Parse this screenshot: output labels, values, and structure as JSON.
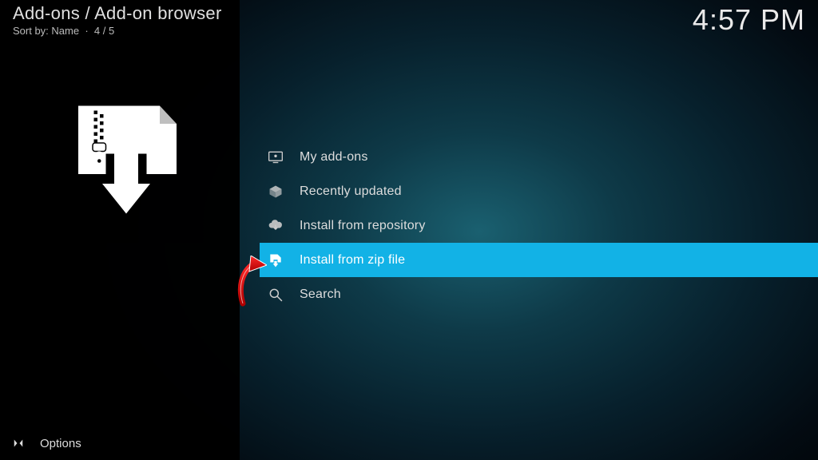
{
  "header": {
    "breadcrumb": "Add-ons / Add-on browser",
    "sort_label": "Sort by: Name",
    "position_label": "4 / 5",
    "clock": "4:57 PM"
  },
  "menu": {
    "items": [
      {
        "icon": "monitor-icon",
        "label": "My add-ons",
        "selected": false
      },
      {
        "icon": "openbox-icon",
        "label": "Recently updated",
        "selected": false
      },
      {
        "icon": "cloud-download-icon",
        "label": "Install from repository",
        "selected": false
      },
      {
        "icon": "zip-download-icon",
        "label": "Install from zip file",
        "selected": true
      },
      {
        "icon": "search-icon",
        "label": "Search",
        "selected": false
      }
    ]
  },
  "footer": {
    "options_label": "Options"
  },
  "colors": {
    "accent": "#12b2e6",
    "text": "#dddddd",
    "annotation": "#d90000"
  }
}
